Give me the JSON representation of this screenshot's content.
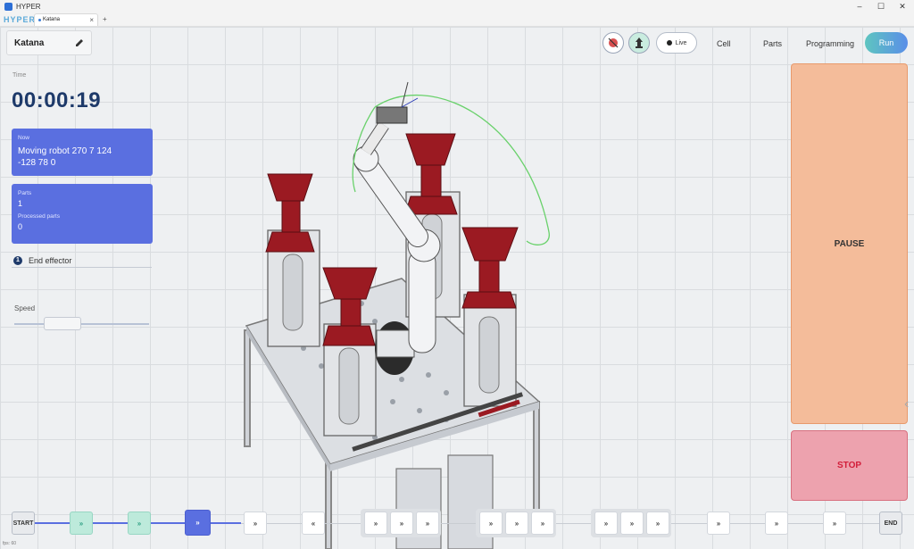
{
  "window": {
    "title": "HYPER",
    "logo": "HYPER",
    "tab_label": "Katana",
    "min": "–",
    "max": "☐",
    "close": "✕",
    "tab_close": "×",
    "tab_add": "+"
  },
  "project": {
    "name": "Katana",
    "edit_icon": "pencil-icon"
  },
  "time": {
    "label": "Time",
    "value": "00:00:19"
  },
  "now_card": {
    "label": "Now",
    "text_line1": "Moving robot 270 7 124",
    "text_line2": "-128 78 0"
  },
  "parts_card": {
    "parts_label": "Parts",
    "parts_value": "1",
    "processed_label": "Processed parts",
    "processed_value": "0"
  },
  "end_effector": {
    "info": "1",
    "label": "End effector"
  },
  "speed": {
    "label": "Speed",
    "value_fraction": 0.3
  },
  "nav": {
    "live_label": "Live",
    "cell": "Cell",
    "parts": "Parts",
    "programming": "Programming",
    "run": "Run"
  },
  "controls": {
    "pause": "PAUSE",
    "stop": "STOP"
  },
  "timeline": {
    "start": "START",
    "end": "END",
    "done_glyph": "»",
    "pending_glyph": "»",
    "up_glyph": "«"
  },
  "fps": "fps: 60",
  "colors": {
    "accent": "#5a6fe0",
    "pause": "#f4bc9a",
    "stop": "#eda2ae",
    "done": "#bdeadb",
    "part": "#9b1a22"
  }
}
